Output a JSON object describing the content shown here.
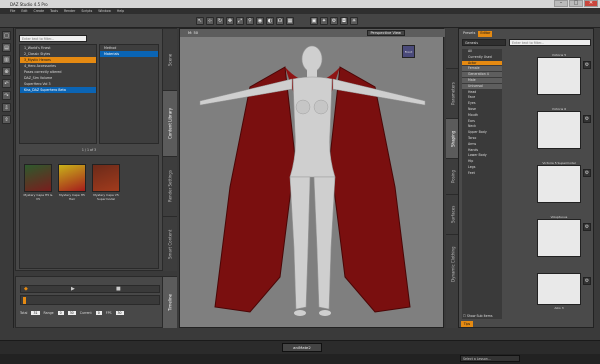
{
  "window": {
    "title": "DAZ Studio 4.5 Pro",
    "min": "–",
    "max": "□",
    "close": "✕"
  },
  "menu": [
    "File",
    "Edit",
    "Create",
    "Tools",
    "Render",
    "Scripts",
    "Window",
    "Help"
  ],
  "content_library": {
    "search_placeholder": "Enter text to filter...",
    "tree": [
      {
        "label": "1_World's Finest",
        "style": ""
      },
      {
        "label": "2_Classic Styles",
        "style": ""
      },
      {
        "label": "3_Mystic Heroes",
        "style": "orange"
      },
      {
        "label": "4_Hero Accessories",
        "style": ""
      },
      {
        "label": "Poses correctly altered",
        "style": ""
      },
      {
        "label": "DAZ_Sim Volume",
        "style": ""
      },
      {
        "label": "SuperHero Vol 3",
        "style": ""
      },
      {
        "label": "Kiss_DAZ Superhero Beta",
        "style": "sel"
      }
    ],
    "subtree": [
      {
        "label": "Method",
        "style": ""
      },
      {
        "label": "Materials",
        "style": "sel"
      }
    ],
    "pager": "1 / 1 of 3",
    "thumbs": [
      {
        "label": "Mystery Cape H5 & V5",
        "badge": "Scene"
      },
      {
        "label": "Mystery Cape H5 Hair",
        "badge": "Scene"
      },
      {
        "label": "Mystery Cape V5 Supermodel",
        "badge": "Scene"
      }
    ]
  },
  "left_tabs": [
    "Smart Content",
    "Render Settings",
    "Content Library",
    "Scene"
  ],
  "timeline": {
    "tab": "Timeline",
    "fields": [
      {
        "label": "Total",
        "value": "31"
      },
      {
        "label": "Range",
        "value": "0"
      },
      {
        "label": "30",
        "value": "30"
      },
      {
        "label": "Current",
        "value": "0"
      },
      {
        "label": "FPS",
        "value": "30"
      }
    ]
  },
  "viewport": {
    "label_left": "M: 50",
    "camera": "Perspective View",
    "cube_label": "Front"
  },
  "right_tabs": [
    "Parameters",
    "Shaping",
    "Posing",
    "Surfaces",
    "Dynamic Clothing"
  ],
  "shaping": {
    "tabs": [
      "Presets",
      "Editor"
    ],
    "dropdown": "Genesis",
    "filter_placeholder": "Enter text to filter...",
    "props": [
      {
        "label": "All",
        "style": ""
      },
      {
        "label": "Currently Used",
        "style": ""
      },
      {
        "label": "Actor",
        "style": "sel"
      },
      {
        "label": "Female",
        "style": "hl"
      },
      {
        "label": "Generation 4",
        "style": "hl"
      },
      {
        "label": "Male",
        "style": "hl"
      },
      {
        "label": "Universal",
        "style": "hl"
      },
      {
        "label": "Head",
        "style": ""
      },
      {
        "label": "Face",
        "style": ""
      },
      {
        "label": "Eyes",
        "style": ""
      },
      {
        "label": "Nose",
        "style": ""
      },
      {
        "label": "Mouth",
        "style": ""
      },
      {
        "label": "Ears",
        "style": ""
      },
      {
        "label": "Neck",
        "style": ""
      },
      {
        "label": "Upper Body",
        "style": ""
      },
      {
        "label": "Torso",
        "style": ""
      },
      {
        "label": "Arms",
        "style": ""
      },
      {
        "label": "Hands",
        "style": ""
      },
      {
        "label": "Lower Body",
        "style": ""
      },
      {
        "label": "Hip",
        "style": ""
      },
      {
        "label": "Legs",
        "style": ""
      },
      {
        "label": "Feet",
        "style": ""
      }
    ],
    "figures": [
      "Victoria 5",
      "Victoria 6",
      "Victoria 5 Supermodel",
      "Voluptuous",
      "Aiko 3"
    ],
    "show_sub_items": "Show Sub Items",
    "tips": "Tips"
  },
  "status": {
    "tab": "aniMate2",
    "lesson": "Select a Lesson..."
  }
}
